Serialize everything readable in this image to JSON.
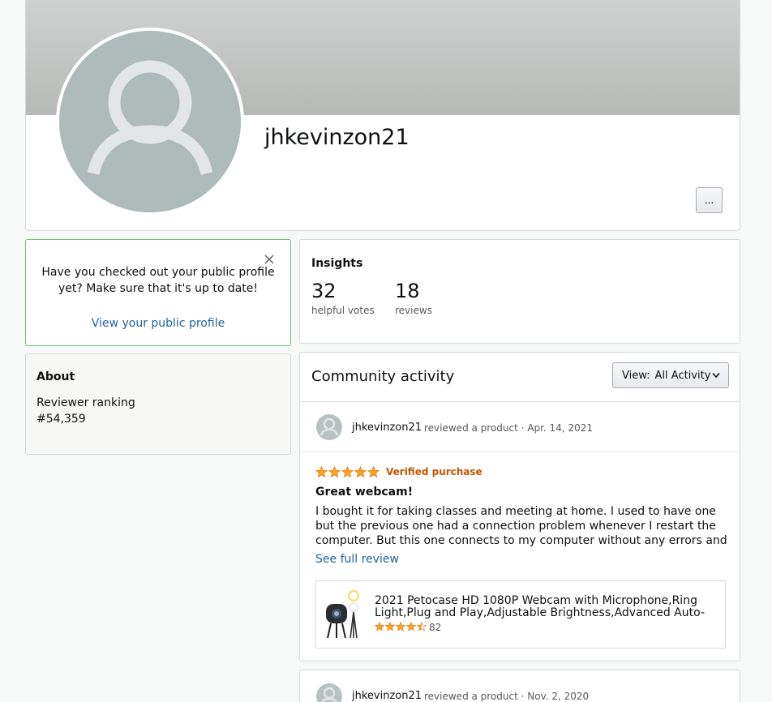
{
  "profile": {
    "username": "jhkevinzon21",
    "more_label": "..."
  },
  "notice": {
    "text": "Have you checked out your public profile yet? Make sure that it's up to date!",
    "link": "View your public profile"
  },
  "about": {
    "title": "About",
    "ranking_label": "Reviewer ranking",
    "ranking_value": "#54,359"
  },
  "insights": {
    "title": "Insights",
    "helpful_votes": "32",
    "helpful_votes_label": "helpful votes",
    "reviews": "18",
    "reviews_label": "reviews"
  },
  "activity": {
    "title": "Community activity",
    "view_label": "View:",
    "view_value": "All Activity",
    "posts": [
      {
        "user": "jhkevinzon21",
        "meta": "reviewed a product · Apr. 14, 2021",
        "rating": 5,
        "verified": "Verified purchase",
        "title": "Great webcam!",
        "body": "I bought it for taking classes and meeting at home. I used to have one but the previous one had a connection problem whenever I restart the computer. But this one connects to my computer without any errors and the resolution is …",
        "see_full": "See full review",
        "product": {
          "title": "2021 Petocase HD 1080P Webcam with Microphone,Ring Light,Plug and Play,Adjustable Brightness,Advanced Auto-Foc…",
          "rating": 4.5,
          "rating_count": "82"
        }
      },
      {
        "user": "jhkevinzon21",
        "meta": "reviewed a product · Nov. 2, 2020"
      }
    ]
  },
  "colors": {
    "link": "#2162a1",
    "verified": "#c45500",
    "star": "#ffa41c",
    "notice_border": "#6cc26f"
  }
}
